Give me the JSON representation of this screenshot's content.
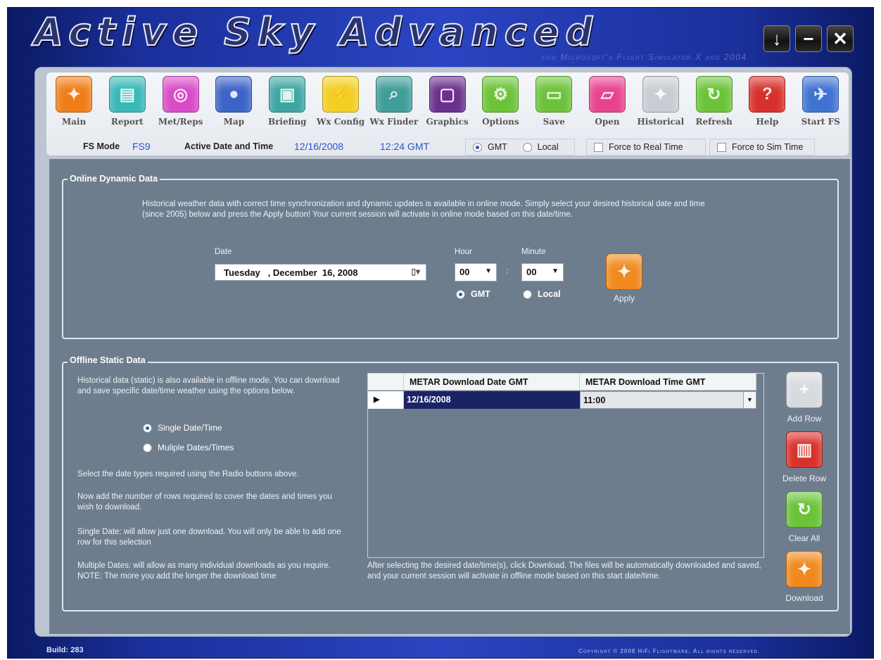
{
  "app": {
    "title": "Active Sky Advanced",
    "subtitle": "for Microsoft's Flight Simulator X and 2004",
    "window_buttons": [
      {
        "name": "download-window-button",
        "glyph": "↓"
      },
      {
        "name": "minimize-button",
        "glyph": "−"
      },
      {
        "name": "close-button",
        "glyph": "✕"
      }
    ]
  },
  "toolbar": {
    "items": [
      {
        "label": "Main",
        "icon": "main-icon",
        "color": "#f07d18",
        "glyph": "✦"
      },
      {
        "label": "Report",
        "icon": "report-icon",
        "color": "#38b8b5",
        "glyph": "▤"
      },
      {
        "label": "Met/Reps",
        "icon": "met-reps-icon",
        "color": "#d94bc7",
        "glyph": "◎"
      },
      {
        "label": "Map",
        "icon": "map-icon",
        "color": "#3d63c6",
        "glyph": "●"
      },
      {
        "label": "Briefing",
        "icon": "briefing-icon",
        "color": "#3ea6a2",
        "glyph": "▣"
      },
      {
        "label": "Wx Config",
        "icon": "wx-config-icon",
        "color": "#f2cf22",
        "glyph": "⚡"
      },
      {
        "label": "Wx Finder",
        "icon": "wx-finder-icon",
        "color": "#3f9d9a",
        "glyph": "⌕"
      },
      {
        "label": "Graphics",
        "icon": "graphics-icon",
        "color": "#6b2f8c",
        "glyph": "▢"
      },
      {
        "label": "Options",
        "icon": "options-icon",
        "color": "#6cc33a",
        "glyph": "⚙"
      },
      {
        "label": "Save",
        "icon": "save-icon",
        "color": "#6cc33a",
        "glyph": "▭"
      },
      {
        "label": "Open",
        "icon": "open-icon",
        "color": "#e8438f",
        "glyph": "▱"
      },
      {
        "label": "Historical",
        "icon": "historical-icon",
        "color": "#c9cdd3",
        "glyph": "✦"
      },
      {
        "label": "Refresh",
        "icon": "refresh-icon",
        "color": "#6cc33a",
        "glyph": "↻"
      },
      {
        "label": "Help",
        "icon": "help-icon",
        "color": "#d8312b",
        "glyph": "?"
      },
      {
        "label": "Start FS",
        "icon": "start-fs-icon",
        "color": "#3f73d1",
        "glyph": "✈"
      }
    ]
  },
  "status": {
    "fs_mode_label": "FS Mode",
    "fs_mode_value": "FS9",
    "active_label": "Active Date and Time",
    "active_date": "12/16/2008",
    "active_time": "12:24 GMT",
    "gmt_label": "GMT",
    "local_label": "Local",
    "force_real_label": "Force to Real Time",
    "force_sim_label": "Force to Sim Time"
  },
  "online": {
    "title": "Online Dynamic Data",
    "description": "Historical weather data with correct time synchronization and dynamic updates is available in online mode.  Simply select your desired historical date and time (since 2005) below and press the Apply button!  Your current session will activate in online mode based on this date/time.",
    "date_label": "Date",
    "date_value": "Tuesday   , December  16, 2008",
    "hour_label": "Hour",
    "hour_value": "00",
    "minute_label": "Minute",
    "minute_value": "00",
    "separator": ":",
    "gmt_label": "GMT",
    "local_label": "Local",
    "apply_label": "Apply"
  },
  "offline": {
    "title": "Offline Static Data",
    "description": "Historical data (static) is also available in offline mode.  You can download and save specific date/time weather using the options below.",
    "single_label": "Single Date/Time",
    "multiple_label": "Muliple Dates/Times",
    "help1": "Select the date types required using the Radio buttons above.",
    "help2": "Now add the number of rows required to cover the dates and times you wish to download.",
    "help3": "Single Date: will allow just one download. You will only be able to add one row for this selection",
    "help4": "Multiple Dates: will allow as many individual downloads as you require. NOTE: The more you add the longer the download time",
    "grid": {
      "columns": [
        "METAR Download Date GMT",
        "METAR Download Time GMT"
      ],
      "rows": [
        [
          "12/16/2008",
          "11:00"
        ]
      ]
    },
    "footer_note": "After selecting the desired date/time(s), click Download.  The files will be automatically downloaded and saved, and your current session will activate in offline mode based on this start date/time.",
    "add_row_label": "Add Row",
    "delete_row_label": "Delete Row",
    "clear_all_label": "Clear All",
    "download_label": "Download"
  },
  "footer": {
    "build": "Build: 283",
    "copyright": "Copyright © 2008 HiFi Flightware. All rights reserved."
  }
}
